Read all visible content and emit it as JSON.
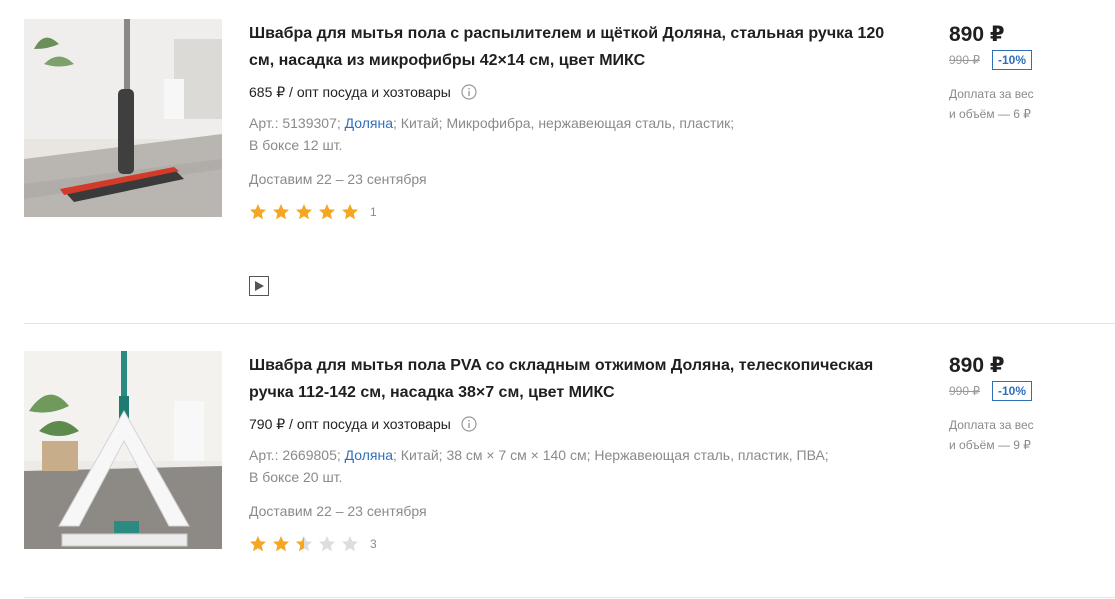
{
  "products": [
    {
      "title": "Швабра для мытья пола с распылителем и щёткой Доляна, стальная ручка 120 см, насадка из микрофибры 42×14 см, цвет МИКС",
      "opt_price": "685 ₽ / опт посуда и хозтовары",
      "article": "Арт.: 5139307;",
      "brand": "Доляна",
      "country": "; Китай;",
      "materials": "Микрофибра, нержавеющая сталь, пластик;",
      "box": "В боксе 12 шт.",
      "delivery": "Доставим 22 – 23 сентября",
      "rating": 5,
      "reviews": "1",
      "price": "890 ₽",
      "old_price": "990 ₽",
      "discount": "-10%",
      "surcharge_1": "Доплата за вес",
      "surcharge_2": "и объём — 6 ₽"
    },
    {
      "title": "Швабра для мытья пола PVA со складным отжимом Доляна, телескопическая ручка 112-142 см, насадка 38×7 см, цвет МИКС",
      "opt_price": "790 ₽ / опт посуда и хозтовары",
      "article": "Арт.: 2669805;",
      "brand": "Доляна",
      "country": "; Китай;",
      "materials": "38 см × 7 см × 140 см; Нержавеющая сталь, пластик, ПВА;",
      "box": "В боксе 20 шт.",
      "delivery": "Доставим 22 – 23 сентября",
      "rating": 2.5,
      "reviews": "3",
      "price": "890 ₽",
      "old_price": "990 ₽",
      "discount": "-10%",
      "surcharge_1": "Доплата за вес",
      "surcharge_2": "и объём — 9 ₽"
    }
  ],
  "colors": {
    "accent": "#2f6fba",
    "star": "#f5a623",
    "star_empty": "#dddddd"
  }
}
